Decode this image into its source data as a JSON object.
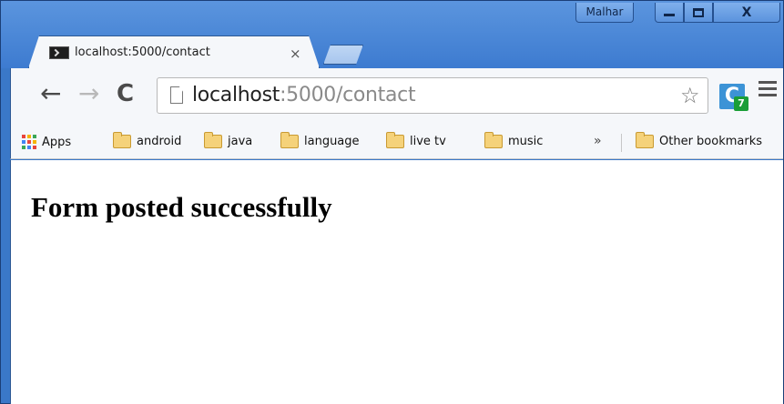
{
  "window": {
    "user_name": "Malhar",
    "minimize_icon": "minimize-icon",
    "maximize_icon": "maximize-icon",
    "close_label": "X"
  },
  "tabs": [
    {
      "title": "localhost:5000/contact",
      "icon": "terminal-favicon",
      "close": "×"
    }
  ],
  "toolbar": {
    "back_glyph": "←",
    "forward_glyph": "→",
    "reload_glyph": "C",
    "url_host": "localhost",
    "url_path": ":5000/contact",
    "star_glyph": "☆",
    "extension_letter": "C",
    "extension_badge": "7"
  },
  "bookmarks": {
    "items": [
      {
        "label": "Apps",
        "icon": "apps-grid-icon"
      },
      {
        "label": "android",
        "icon": "folder-icon"
      },
      {
        "label": "java",
        "icon": "folder-icon"
      },
      {
        "label": "language",
        "icon": "folder-icon"
      },
      {
        "label": "live tv",
        "icon": "folder-icon"
      },
      {
        "label": "music",
        "icon": "folder-icon"
      }
    ],
    "overflow": "»",
    "other": "Other bookmarks"
  },
  "page": {
    "heading": "Form posted successfully"
  },
  "colors": {
    "frame": "#3d7bd0",
    "toolbar": "#f5f7fa",
    "extension": "#3c93d6",
    "folder": "#f5d27a"
  }
}
